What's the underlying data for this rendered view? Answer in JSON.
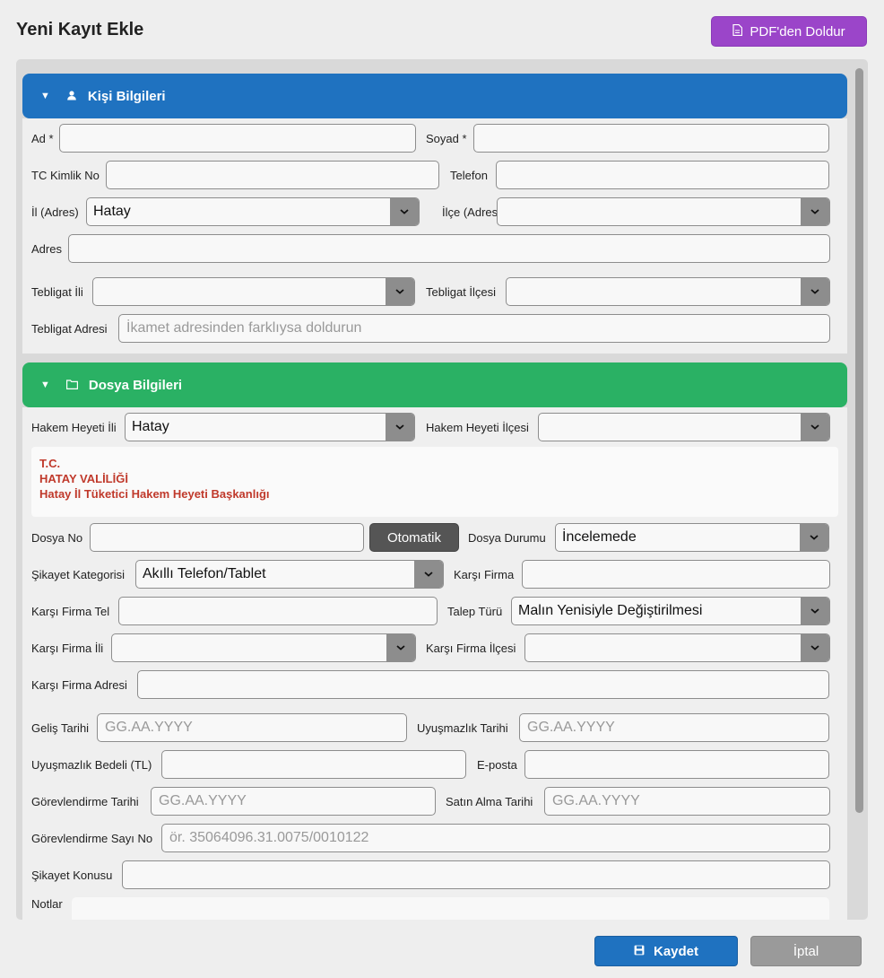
{
  "header": {
    "title": "Yeni Kayıt Ekle",
    "pdf_button": "PDF'den Doldur"
  },
  "sections": {
    "person": {
      "title": "Kişi Bilgileri",
      "color": "#1f72c0"
    },
    "file": {
      "title": "Dosya Bilgileri",
      "color": "#2ab164"
    }
  },
  "person": {
    "ad_label": "Ad *",
    "ad_value": "",
    "soyad_label": "Soyad *",
    "soyad_value": "",
    "tc_label": "TC Kimlik No",
    "tc_value": "",
    "telefon_label": "Telefon",
    "telefon_value": "",
    "il_label": "İl (Adres)",
    "il_value": "Hatay",
    "ilce_label": "İlçe (Adres)",
    "ilce_value": "",
    "adres_label": "Adres",
    "adres_value": "",
    "tebligat_il_label": "Tebligat İli",
    "tebligat_il_value": "",
    "tebligat_ilce_label": "Tebligat İlçesi",
    "tebligat_ilce_value": "",
    "tebligat_adres_label": "Tebligat Adresi",
    "tebligat_adres_placeholder": "İkamet adresinden farklıysa doldurun"
  },
  "file": {
    "hakem_il_label": "Hakem Heyeti İli",
    "hakem_il_value": "Hatay",
    "hakem_ilce_label": "Hakem Heyeti İlçesi",
    "hakem_ilce_value": "",
    "info_line1": "T.C.",
    "info_line2": "HATAY VALİLİĞİ",
    "info_line3": "Hatay İl Tüketici Hakem Heyeti Başkanlığı",
    "dosya_no_label": "Dosya No",
    "dosya_no_value": "",
    "otomatik_button": "Otomatik",
    "dosya_durumu_label": "Dosya Durumu",
    "dosya_durumu_value": "İncelemede",
    "sikayet_kategori_label": "Şikayet Kategorisi",
    "sikayet_kategori_value": "Akıllı Telefon/Tablet",
    "karsi_firma_label": "Karşı Firma",
    "karsi_firma_value": "",
    "karsi_firma_tel_label": "Karşı Firma Tel",
    "karsi_firma_tel_value": "",
    "talep_turu_label": "Talep Türü",
    "talep_turu_value": "Malın Yenisiyle Değiştirilmesi",
    "karsi_firma_il_label": "Karşı Firma İli",
    "karsi_firma_il_value": "",
    "karsi_firma_ilce_label": "Karşı Firma İlçesi",
    "karsi_firma_ilce_value": "",
    "karsi_firma_adres_label": "Karşı Firma Adresi",
    "karsi_firma_adres_value": "",
    "gelis_tarihi_label": "Geliş Tarihi",
    "gelis_tarihi_placeholder": "GG.AA.YYYY",
    "uyusmazlik_tarihi_label": "Uyuşmazlık Tarihi",
    "uyusmazlik_tarihi_placeholder": "GG.AA.YYYY",
    "uyusmazlik_bedeli_label": "Uyuşmazlık Bedeli (TL)",
    "uyusmazlik_bedeli_value": "",
    "eposta_label": "E-posta",
    "eposta_value": "",
    "gorevlendirme_tarihi_label": "Görevlendirme Tarihi",
    "gorevlendirme_tarihi_placeholder": "GG.AA.YYYY",
    "satin_alma_tarihi_label": "Satın Alma Tarihi",
    "satin_alma_tarihi_placeholder": "GG.AA.YYYY",
    "gorevlendirme_sayi_label": "Görevlendirme Sayı No",
    "gorevlendirme_sayi_placeholder": "ör. 35064096.31.0075/0010122",
    "sikayet_konusu_label": "Şikayet Konusu",
    "sikayet_konusu_value": "",
    "notlar_label": "Notlar"
  },
  "footer": {
    "save_button": "Kaydet",
    "cancel_button": "İptal"
  },
  "icons": {
    "pdf": "file-icon",
    "person": "user-icon",
    "folder": "folder-icon",
    "save": "floppy-disk-icon",
    "collapse": "triangle-down-icon",
    "dropdown": "chevron-down-icon"
  }
}
